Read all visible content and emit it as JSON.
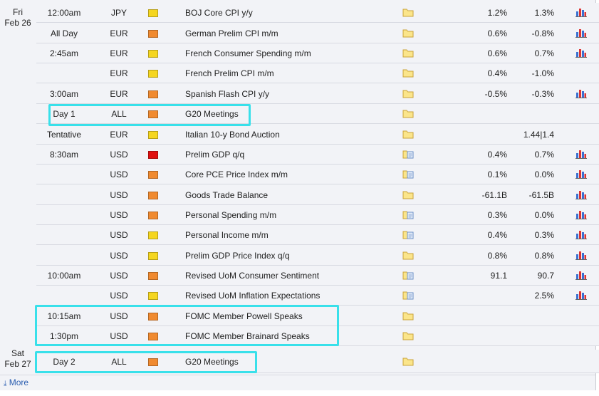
{
  "dates": [
    {
      "day": "Fri",
      "date": "Feb 26"
    },
    {
      "day": "Sat",
      "date": "Feb 27"
    }
  ],
  "rows": [
    {
      "time": "12:00am",
      "currency": "JPY",
      "impact": "low",
      "event": "BOJ Core CPI y/y",
      "actual": "1.2%",
      "forecast": "1.3%",
      "chart": true,
      "file": "plain"
    },
    {
      "time": "All Day",
      "currency": "EUR",
      "impact": "medium",
      "event": "German Prelim CPI m/m",
      "actual": "0.6%",
      "forecast": "-0.8%",
      "chart": true,
      "file": "plain"
    },
    {
      "time": "2:45am",
      "currency": "EUR",
      "impact": "low",
      "event": "French Consumer Spending m/m",
      "actual": "0.6%",
      "forecast": "0.7%",
      "chart": true,
      "file": "plain"
    },
    {
      "time": "",
      "currency": "EUR",
      "impact": "low",
      "event": "French Prelim CPI m/m",
      "actual": "0.4%",
      "forecast": "-1.0%",
      "chart": false,
      "file": "plain"
    },
    {
      "time": "3:00am",
      "currency": "EUR",
      "impact": "medium",
      "event": "Spanish Flash CPI y/y",
      "actual": "-0.5%",
      "forecast": "-0.3%",
      "chart": true,
      "file": "plain"
    },
    {
      "time": "Day 1",
      "currency": "ALL",
      "impact": "medium",
      "event": "G20 Meetings",
      "actual": "",
      "forecast": "",
      "chart": false,
      "file": "plain"
    },
    {
      "time": "Tentative",
      "currency": "EUR",
      "impact": "low",
      "event": "Italian 10-y Bond Auction",
      "actual": "",
      "forecast": "1.44|1.4",
      "chart": false,
      "file": "plain"
    },
    {
      "time": "8:30am",
      "currency": "USD",
      "impact": "high",
      "event": "Prelim GDP q/q",
      "actual": "0.4%",
      "forecast": "0.7%",
      "chart": true,
      "file": "doc"
    },
    {
      "time": "",
      "currency": "USD",
      "impact": "medium",
      "event": "Core PCE Price Index m/m",
      "actual": "0.1%",
      "forecast": "0.0%",
      "chart": true,
      "file": "doc"
    },
    {
      "time": "",
      "currency": "USD",
      "impact": "medium",
      "event": "Goods Trade Balance",
      "actual": "-61.1B",
      "forecast": "-61.5B",
      "chart": true,
      "file": "plain"
    },
    {
      "time": "",
      "currency": "USD",
      "impact": "medium",
      "event": "Personal Spending m/m",
      "actual": "0.3%",
      "forecast": "0.0%",
      "chart": true,
      "file": "doc"
    },
    {
      "time": "",
      "currency": "USD",
      "impact": "low",
      "event": "Personal Income m/m",
      "actual": "0.4%",
      "forecast": "0.3%",
      "chart": true,
      "file": "doc"
    },
    {
      "time": "",
      "currency": "USD",
      "impact": "low",
      "event": "Prelim GDP Price Index q/q",
      "actual": "0.8%",
      "forecast": "0.8%",
      "chart": true,
      "file": "plain"
    },
    {
      "time": "10:00am",
      "currency": "USD",
      "impact": "medium",
      "event": "Revised UoM Consumer Sentiment",
      "actual": "91.1",
      "forecast": "90.7",
      "chart": true,
      "file": "doc"
    },
    {
      "time": "",
      "currency": "USD",
      "impact": "low",
      "event": "Revised UoM Inflation Expectations",
      "actual": "",
      "forecast": "2.5%",
      "chart": true,
      "file": "doc"
    },
    {
      "time": "10:15am",
      "currency": "USD",
      "impact": "medium",
      "event": "FOMC Member Powell Speaks",
      "actual": "",
      "forecast": "",
      "chart": false,
      "file": "plain"
    },
    {
      "time": "1:30pm",
      "currency": "USD",
      "impact": "medium",
      "event": "FOMC Member Brainard Speaks",
      "actual": "",
      "forecast": "",
      "chart": false,
      "file": "plain"
    },
    {
      "time": "Day 2",
      "currency": "ALL",
      "impact": "medium",
      "event": "G20 Meetings",
      "actual": "",
      "forecast": "",
      "chart": false,
      "file": "plain"
    }
  ],
  "colors": {
    "high": "#e01010",
    "medium": "#f08a30",
    "low": "#f5d620",
    "highlight": "#39e0ea"
  },
  "footer": {
    "more_label": "More",
    "more_icon": "download-arrow-icon"
  }
}
